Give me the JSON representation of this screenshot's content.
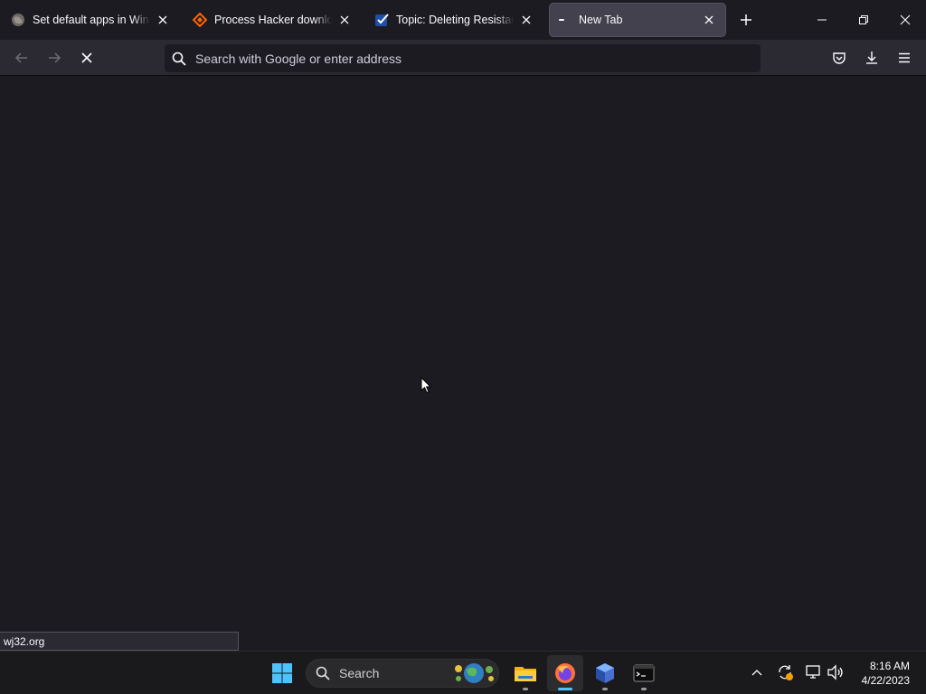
{
  "browser": {
    "tabs": [
      {
        "title": "Set default apps in Windows",
        "active": false
      },
      {
        "title": "Process Hacker download |",
        "active": false
      },
      {
        "title": "Topic: Deleting Resistant Wi",
        "active": false
      },
      {
        "title": "New Tab",
        "active": true
      }
    ],
    "urlbar": {
      "placeholder": "Search with Google or enter address",
      "value": ""
    },
    "status_text": "wj32.org",
    "loading": true
  },
  "taskbar": {
    "search_label": "Search",
    "apps": [
      {
        "icon": "start-windows-icon"
      },
      {
        "icon": "file-explorer-icon"
      },
      {
        "icon": "firefox-icon",
        "active": true
      },
      {
        "icon": "app-cube-icon"
      },
      {
        "icon": "terminal-icon"
      }
    ],
    "clock": {
      "time": "8:16 AM",
      "date": "4/22/2023"
    }
  },
  "colors": {
    "accent": "#4cc2ff",
    "toolbar": "#2b2a33",
    "background": "#1c1b22",
    "active_tab": "#42414d"
  }
}
